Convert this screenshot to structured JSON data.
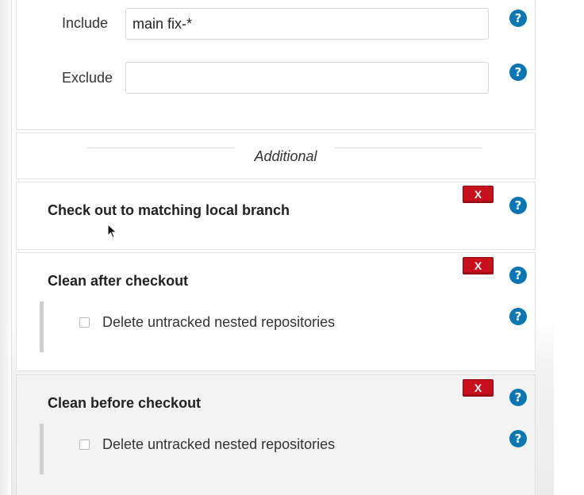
{
  "branch_filter": {
    "include_label": "Include",
    "include_value": "main fix-*",
    "exclude_label": "Exclude",
    "exclude_value": ""
  },
  "additional": {
    "header": "Additional"
  },
  "behaviours": [
    {
      "title": "Check out to matching local branch",
      "delete_label": "X"
    },
    {
      "title": "Clean after checkout",
      "delete_label": "X",
      "option_label": "Delete untracked nested repositories",
      "option_checked": false
    },
    {
      "title": "Clean before checkout",
      "delete_label": "X",
      "option_label": "Delete untracked nested repositories",
      "option_checked": false
    }
  ],
  "icons": {
    "help": "help-icon",
    "delete": "delete-icon",
    "cursor": "mouse-pointer-icon"
  },
  "colors": {
    "help_blue": "#0b76b4",
    "delete_red": "#c8101c"
  }
}
